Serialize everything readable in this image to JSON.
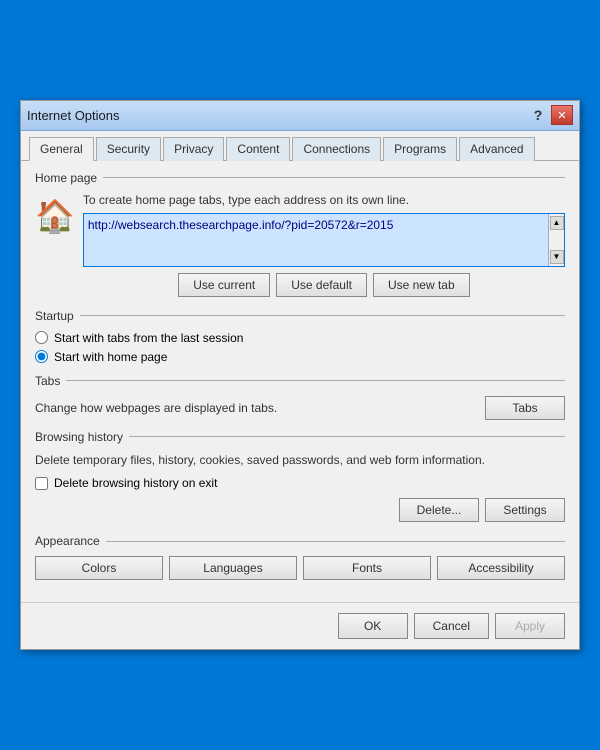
{
  "titlebar": {
    "title": "Internet Options",
    "help_label": "?",
    "close_label": "✕"
  },
  "tabs": [
    {
      "label": "General",
      "active": true
    },
    {
      "label": "Security",
      "active": false
    },
    {
      "label": "Privacy",
      "active": false
    },
    {
      "label": "Content",
      "active": false
    },
    {
      "label": "Connections",
      "active": false
    },
    {
      "label": "Programs",
      "active": false
    },
    {
      "label": "Advanced",
      "active": false
    }
  ],
  "sections": {
    "home_page": {
      "title": "Home page",
      "desc": "To create home page tabs, type each address on its own line.",
      "url": "http://websearch.thesearchpage.info/?pid=20572&r=2015",
      "btn_current": "Use current",
      "btn_default": "Use default",
      "btn_new_tab": "Use new tab"
    },
    "startup": {
      "title": "Startup",
      "option1": "Start with tabs from the last session",
      "option2": "Start with home page",
      "option2_selected": true
    },
    "tabs_section": {
      "title": "Tabs",
      "desc": "Change how webpages are displayed in tabs.",
      "btn_tabs": "Tabs"
    },
    "browsing_history": {
      "title": "Browsing history",
      "desc": "Delete temporary files, history, cookies, saved passwords, and web form information.",
      "checkbox_label": "Delete browsing history on exit",
      "btn_delete": "Delete...",
      "btn_settings": "Settings"
    },
    "appearance": {
      "title": "Appearance",
      "btn_colors": "Colors",
      "btn_languages": "Languages",
      "btn_fonts": "Fonts",
      "btn_accessibility": "Accessibility"
    }
  },
  "footer": {
    "btn_ok": "OK",
    "btn_cancel": "Cancel",
    "btn_apply": "Apply"
  }
}
